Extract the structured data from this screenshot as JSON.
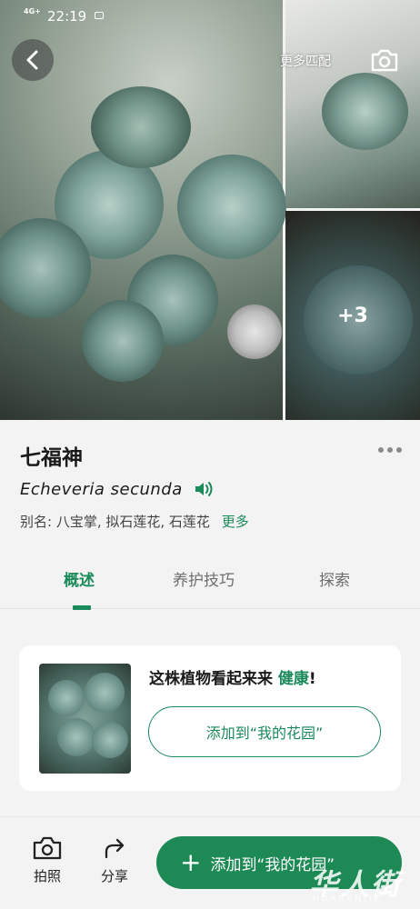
{
  "status_bar": {
    "network": "4G+",
    "time": "22:19"
  },
  "header": {
    "more_matches_label": "更多匹配",
    "extra_photos_label": "+3"
  },
  "plant": {
    "name": "七福神",
    "scientific_name": "Echeveria  secunda",
    "alias_prefix": "别名:",
    "alias_values": "八宝掌, 拟石莲花, 石莲花",
    "alias_more": "更多"
  },
  "tabs": [
    {
      "label": "概述",
      "active": true
    },
    {
      "label": "养护技巧",
      "active": false
    },
    {
      "label": "探索",
      "active": false
    }
  ],
  "health_card": {
    "text_prefix": "这株植物看起来来",
    "status": "健康",
    "text_suffix": "!",
    "button_label": "添加到“我的花园”"
  },
  "bottom_bar": {
    "photo_label": "拍照",
    "share_label": "分享",
    "add_label": "添加到“我的花园”"
  },
  "watermark": {
    "main": "华人街",
    "sub": "HUARENJIE"
  },
  "colors": {
    "accent": "#1d8a56",
    "background": "#f3f3f3",
    "card": "#ffffff"
  },
  "icons": [
    "back-arrow-icon",
    "camera-icon",
    "more-dots-icon",
    "speaker-icon",
    "share-icon",
    "plus-icon"
  ]
}
